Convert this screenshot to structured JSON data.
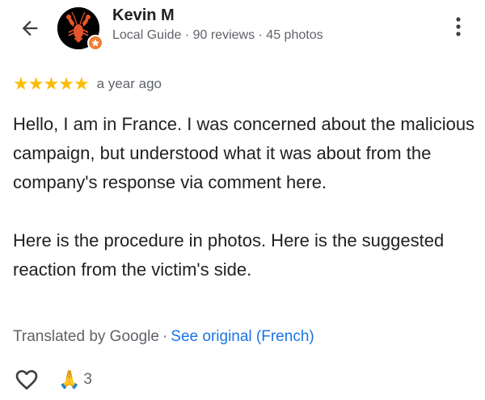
{
  "header": {
    "back_icon": "arrow-left-icon",
    "more_icon": "more-vert-icon",
    "reviewer": {
      "name": "Kevin M",
      "meta": "Local Guide · 90 reviews · 45 photos",
      "avatar_icon": "lobster-logo-avatar",
      "badge_icon": "local-guide-star-badge"
    }
  },
  "review": {
    "rating": 5,
    "rating_max": 5,
    "date": "a year ago",
    "paragraphs": [
      "Hello, I am in France. I was concerned about the malicious campaign, but understood what it was about from the company's response via comment here.",
      "Here is the procedure in photos. Here is the suggested reaction from the victim's side."
    ],
    "translated_label": "Translated by Google",
    "separator": "·",
    "see_original_label": "See original (French)"
  },
  "actions": {
    "like_icon": "heart-outline-icon",
    "reaction_emoji": "🙏",
    "reaction_count": "3"
  },
  "colors": {
    "star": "#fbbc04",
    "link": "#1a73e8",
    "secondary_text": "#5f6368",
    "badge": "#f07d31"
  }
}
